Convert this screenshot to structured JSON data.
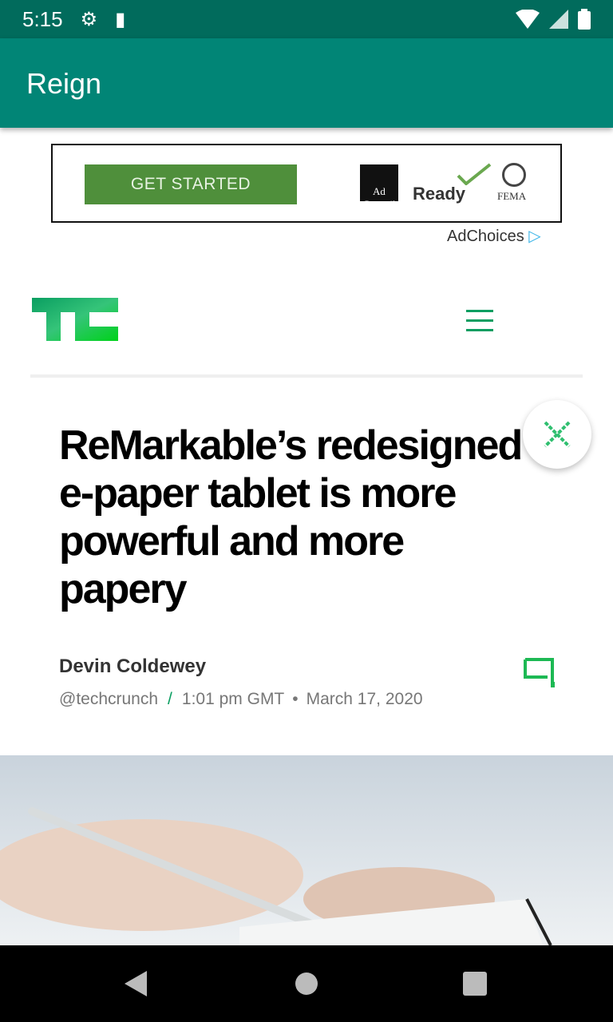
{
  "status_bar": {
    "time": "5:15",
    "icons": [
      "gear-icon",
      "sd-card-icon",
      "wifi-icon",
      "signal-icon",
      "battery-icon"
    ]
  },
  "app_bar": {
    "title": "Reign"
  },
  "ad": {
    "cta": "GET STARTED",
    "logo_adcouncil": "Ad Council",
    "logo_ready": "Ready",
    "logo_fema": "FEMA",
    "adchoices": "AdChoices"
  },
  "article": {
    "title": "ReMarkable’s redesigned e-paper tablet is more powerful and more papery",
    "author": "Devin Coldewey",
    "handle": "@techcrunch",
    "separator": "/",
    "time": "1:01 pm GMT",
    "bullet": "•",
    "date": "March 17, 2020"
  },
  "colors": {
    "status": "#016b5c",
    "appbar": "#018576",
    "brand": "#0a9e61"
  }
}
